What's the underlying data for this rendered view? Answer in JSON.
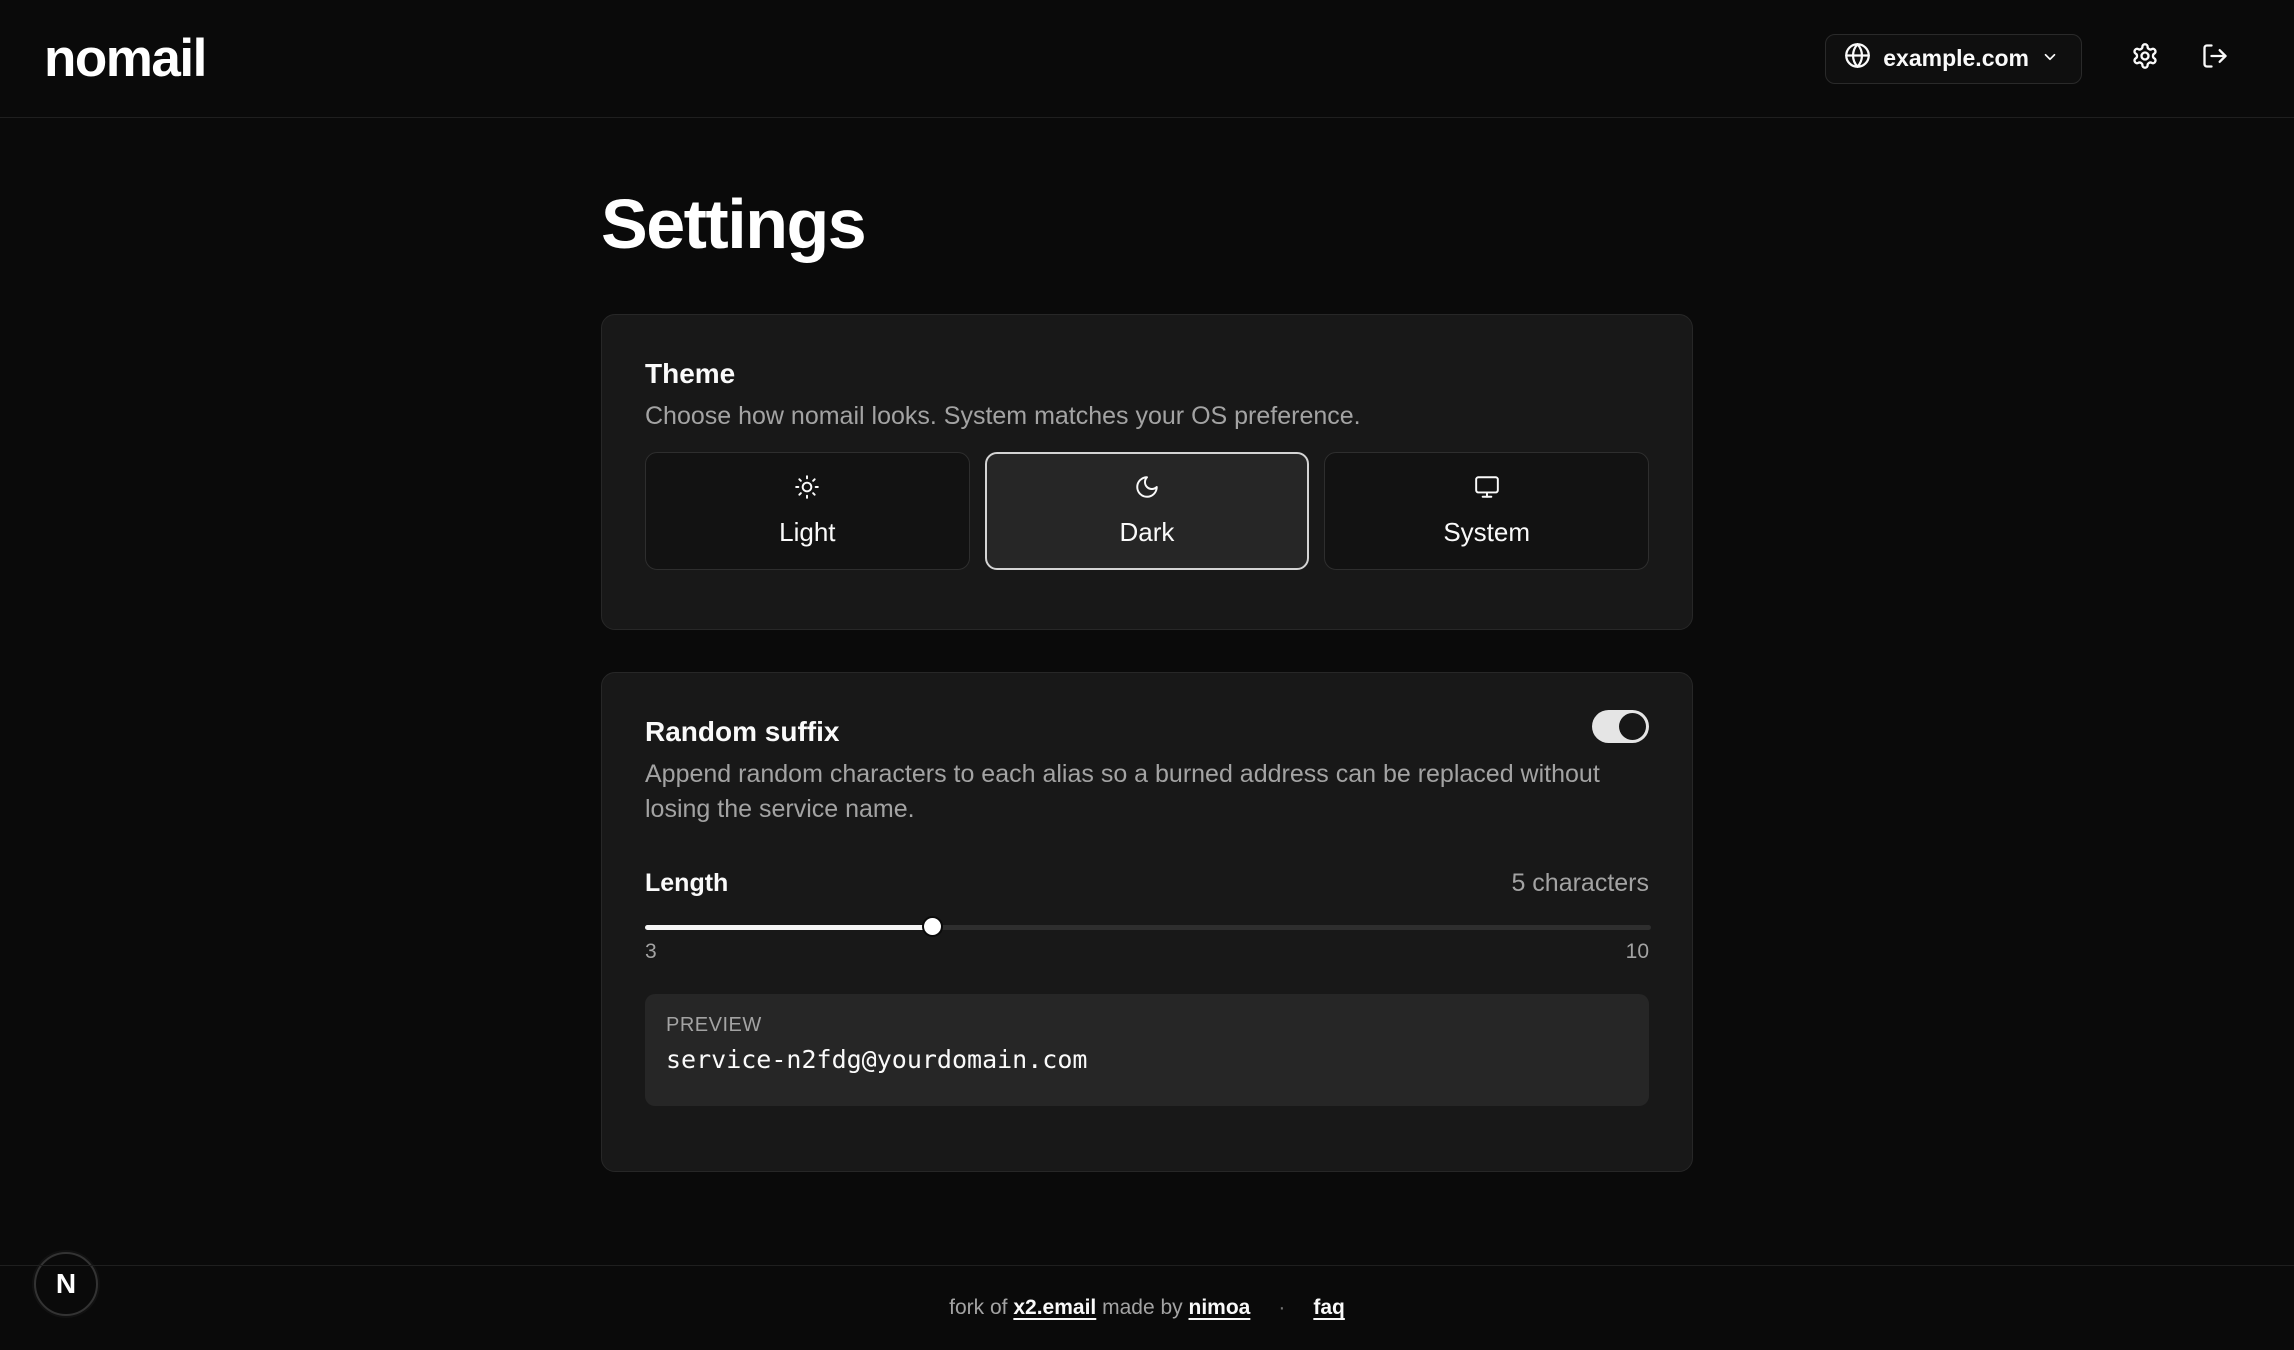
{
  "header": {
    "logo": "nomail",
    "domain_select": {
      "value": "example.com",
      "icon": "globe-icon",
      "chevron": "chevron-down-icon"
    },
    "settings_icon": "gear-icon",
    "logout_icon": "logout-icon"
  },
  "main": {
    "title": "Settings",
    "theme": {
      "title": "Theme",
      "description": "Choose how nomail looks. System matches your OS preference.",
      "options": [
        {
          "label": "Light",
          "icon": "sun-icon",
          "selected": false
        },
        {
          "label": "Dark",
          "icon": "moon-icon",
          "selected": true
        },
        {
          "label": "System",
          "icon": "monitor-icon",
          "selected": false
        }
      ]
    },
    "random_suffix": {
      "title": "Random suffix",
      "enabled": true,
      "description": "Append random characters to each alias so a burned address can be replaced without losing the service name.",
      "length_label": "Length",
      "length_value_text": "5 characters",
      "slider": {
        "min": 3,
        "max": 10,
        "value": 5,
        "min_label": "3",
        "max_label": "10"
      },
      "preview_label": "PREVIEW",
      "preview_value": "service-n2fdg@yourdomain.com"
    }
  },
  "footer": {
    "prefix": "fork of",
    "link1": "x2.email",
    "middle": "made by",
    "link2": "nimoa",
    "separator": "·",
    "link3": "faq"
  },
  "dev_badge": "N",
  "colors": {
    "background": "#0a0a0a",
    "card": "#181818",
    "text": "#fafafa",
    "muted": "#a3a3a3"
  }
}
